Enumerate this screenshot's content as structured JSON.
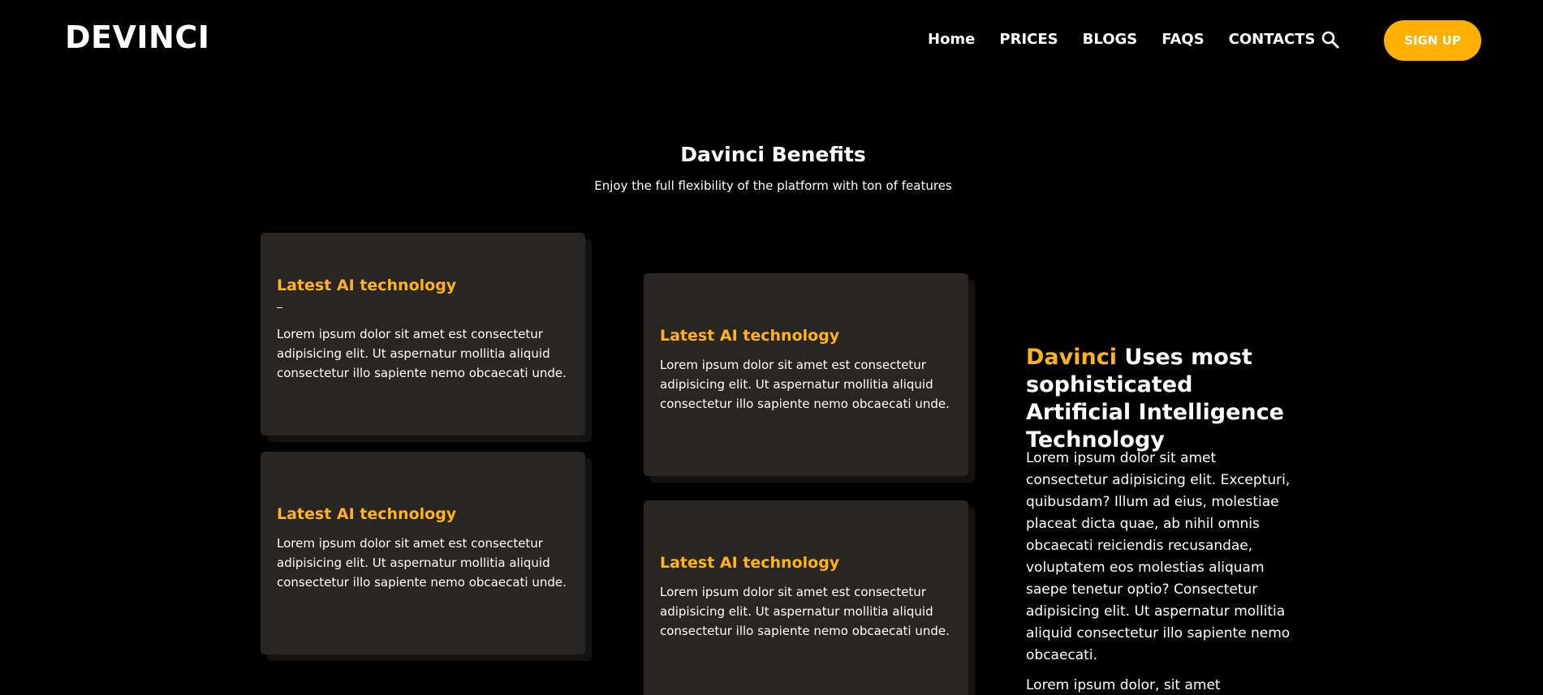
{
  "header": {
    "logo": "DEVINCI",
    "nav": [
      "Home",
      "PRICES",
      "BLOGS",
      "FAQS",
      "CONTACTS"
    ],
    "search_icon": "search-icon",
    "signup_label": "SIGN UP"
  },
  "colors": {
    "background": "#000000",
    "card": "#282522",
    "accent": "#ffb000",
    "accent_text": "#ffb21c"
  },
  "benefits": {
    "title": "Davinci Benefits",
    "subtitle": "Enjoy the full flexibility of the platform with ton of features",
    "cards": [
      {
        "title": "Latest AI technology",
        "text": "Lorem ipsum dolor sit amet est consectetur adipisicing elit. Ut aspernatur mollitia aliquid consectetur illo sapiente nemo obcaecati unde."
      },
      {
        "title": "Latest AI technology",
        "text": "Lorem ipsum dolor sit amet est consectetur adipisicing elit. Ut aspernatur mollitia aliquid consectetur illo sapiente nemo obcaecati unde."
      },
      {
        "title": "Latest AI technology",
        "text": "Lorem ipsum dolor sit amet est consectetur adipisicing elit. Ut aspernatur mollitia aliquid consectetur illo sapiente nemo obcaecati unde."
      },
      {
        "title": "Latest AI technology",
        "text": "Lorem ipsum dolor sit amet est consectetur adipisicing elit. Ut aspernatur mollitia aliquid consectetur illo sapiente nemo obcaecati unde."
      }
    ]
  },
  "feature": {
    "title_accent": "Davinci",
    "title_rest": " Uses most sophisticated Artificial Intelligence Technology",
    "paragraph1": "Lorem ipsum dolor sit amet consectetur adipisicing elit. Excepturi, quibusdam? Illum ad eius, molestiae placeat dicta quae, ab nihil omnis obcaecati reiciendis recusandae, voluptatem eos molestias aliquam saepe tenetur optio? Consectetur adipisicing elit. Ut aspernatur mollitia aliquid consectetur illo sapiente nemo obcaecati.",
    "paragraph2": "Lorem ipsum dolor, sit amet"
  }
}
